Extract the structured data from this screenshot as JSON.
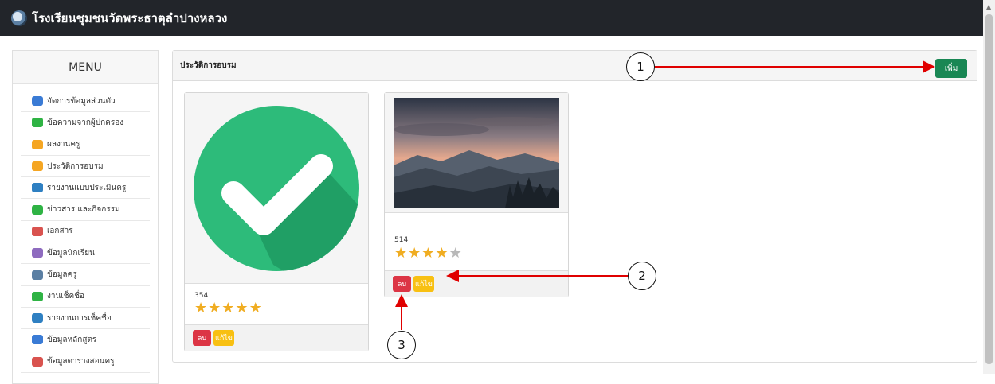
{
  "header": {
    "title": "โรงเรียนชุมชนวัดพระธาตุลำปางหลวง"
  },
  "sidebar": {
    "title": "MENU",
    "items": [
      {
        "label": "จัดการข้อมูลส่วนตัว",
        "icon": "id-card-icon",
        "color": "#3a7bd5"
      },
      {
        "label": "ข้อความจากผู้ปกครอง",
        "icon": "chat-icon",
        "color": "#2fb344"
      },
      {
        "label": "ผลงานครู",
        "icon": "star-icon",
        "color": "#f5a623"
      },
      {
        "label": "ประวัติการอบรม",
        "icon": "star-icon",
        "color": "#f5a623"
      },
      {
        "label": "รายงานแบบประเมินครู",
        "icon": "report-icon",
        "color": "#2f80c2"
      },
      {
        "label": "ข่าวสาร และกิจกรรม",
        "icon": "chat-icon",
        "color": "#2fb344"
      },
      {
        "label": "เอกสาร",
        "icon": "document-icon",
        "color": "#d9534f"
      },
      {
        "label": "ข้อมูลนักเรียน",
        "icon": "student-icon",
        "color": "#8e6bbf"
      },
      {
        "label": "ข้อมูลครู",
        "icon": "teacher-icon",
        "color": "#5b7fa3"
      },
      {
        "label": "งานเช็คชื่อ",
        "icon": "check-icon",
        "color": "#2fb344"
      },
      {
        "label": "รายงานการเช็คชื่อ",
        "icon": "report-icon",
        "color": "#2f80c2"
      },
      {
        "label": "ข้อมูลหลักสูตร",
        "icon": "calendar-icon",
        "color": "#3a7bd5"
      },
      {
        "label": "ข้อมูลตารางสอนครู",
        "icon": "calendar-icon",
        "color": "#d9534f"
      }
    ]
  },
  "panel": {
    "title": "ประวัติการอบรม",
    "add_label": "เพิ่ม"
  },
  "cards": [
    {
      "number": "354",
      "rating": 5,
      "max_rating": 5,
      "image": "check-circle-image",
      "delete_label": "ลบ",
      "edit_label": "แก้ไข"
    },
    {
      "number": "514",
      "rating": 4,
      "max_rating": 5,
      "image": "mountain-sunset-photo",
      "delete_label": "ลบ",
      "edit_label": "แก้ไข"
    }
  ],
  "annotations": [
    {
      "label": "1"
    },
    {
      "label": "2"
    },
    {
      "label": "3"
    }
  ],
  "colors": {
    "topbar": "#22252a",
    "add_button": "#198754",
    "delete_button": "#dc3545",
    "edit_button": "#f8c012",
    "star": "#f0ad22",
    "arrow": "#e00000"
  }
}
